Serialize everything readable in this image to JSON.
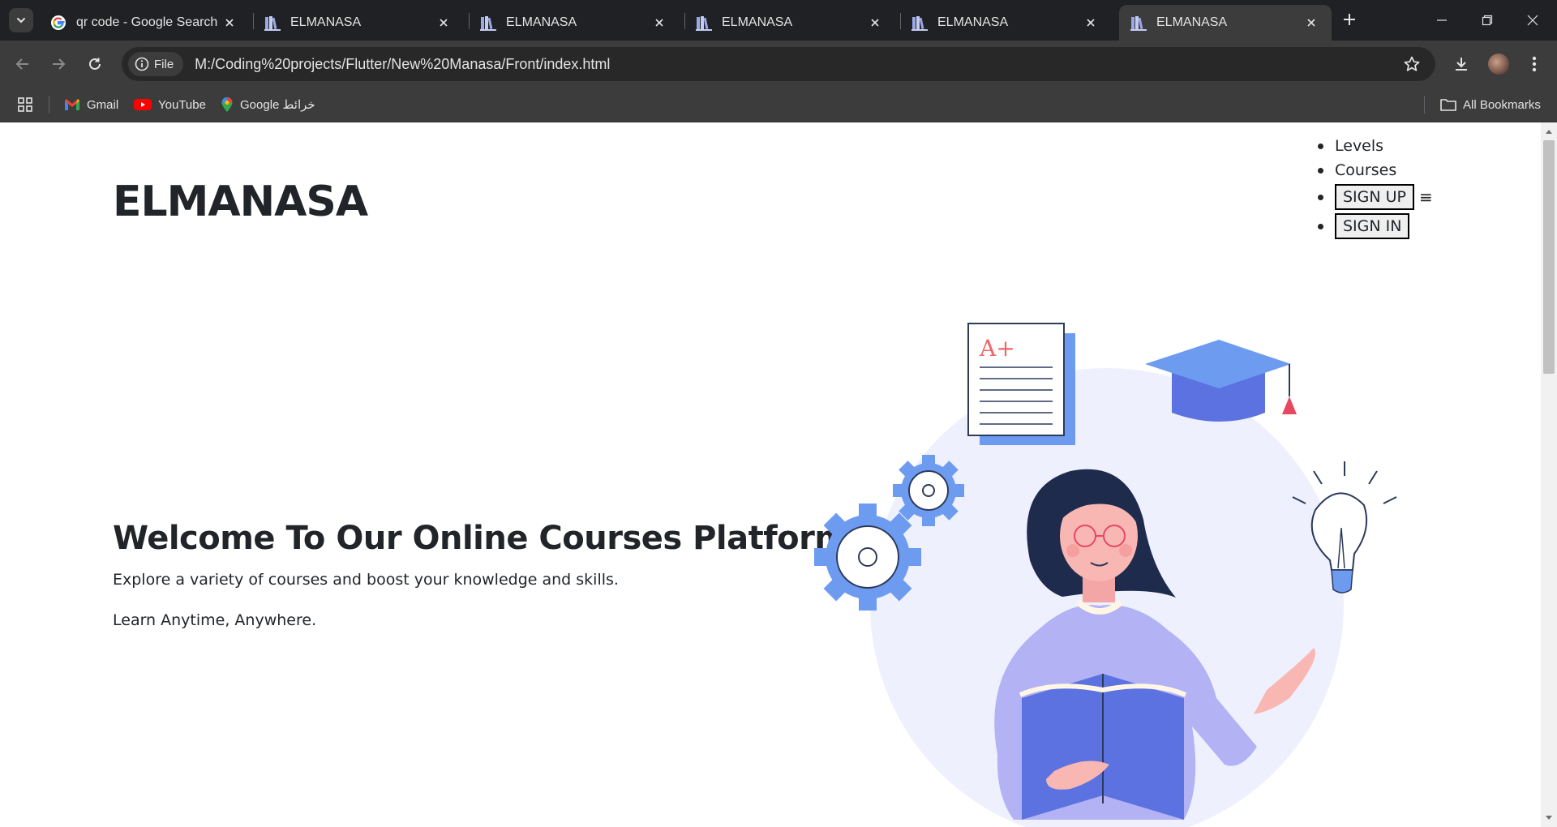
{
  "tabs": [
    {
      "title": "qr code - Google Search",
      "favicon": "google-icon",
      "active": false
    },
    {
      "title": "ELMANASA",
      "favicon": "books-icon",
      "active": false
    },
    {
      "title": "ELMANASA",
      "favicon": "books-icon",
      "active": false
    },
    {
      "title": "ELMANASA",
      "favicon": "books-icon",
      "active": false
    },
    {
      "title": "ELMANASA",
      "favicon": "books-icon",
      "active": false
    },
    {
      "title": "ELMANASA",
      "favicon": "books-icon",
      "active": true
    }
  ],
  "address_bar": {
    "chip_label": "File",
    "url": "M:/Coding%20projects/Flutter/New%20Manasa/Front/index.html"
  },
  "bookmarks": {
    "items": [
      {
        "label": "Gmail",
        "icon": "gmail-icon"
      },
      {
        "label": "YouTube",
        "icon": "youtube-icon"
      },
      {
        "label": "Google خرائط",
        "icon": "maps-icon"
      }
    ],
    "all_bookmarks": "All Bookmarks"
  },
  "site": {
    "brand": "ELMANASA",
    "nav": {
      "levels": "Levels",
      "courses": "Courses",
      "sign_up": "SIGN UP",
      "sign_in": "SIGN IN",
      "menu_icon": "≡"
    },
    "hero": {
      "title": "Welcome To Our Online Courses Platform",
      "subtitle": "Explore a variety of courses and boost your knowledge and skills.",
      "tagline": "Learn Anytime, Anywhere."
    },
    "illustration": {
      "paper_grade": "A+"
    }
  },
  "colors": {
    "chrome_dark": "#202124",
    "chrome_toolbar": "#3c3c3c",
    "accent_blue": "#6d9bf0",
    "accent_indigo": "#5b72e0",
    "lavender": "#b3b2f5",
    "text": "#212529"
  }
}
